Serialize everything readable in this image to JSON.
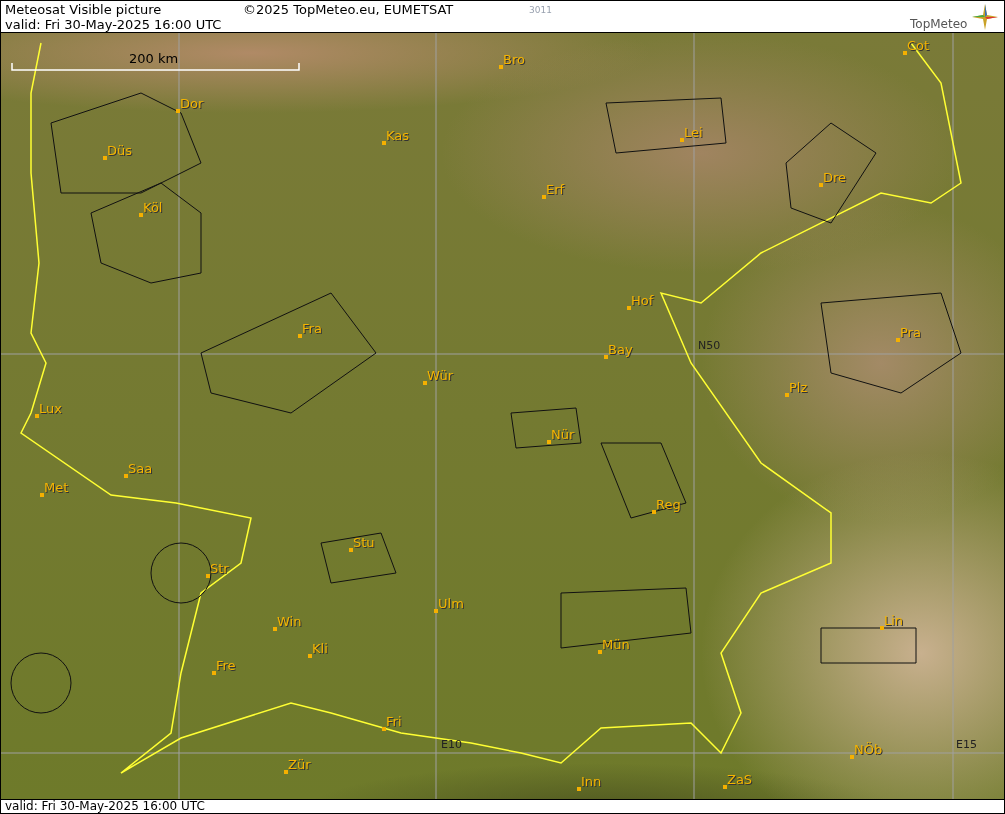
{
  "header": {
    "title": "Meteosat Visible picture",
    "copyright": "©2025 TopMeteo.eu, EUMETSAT",
    "code": "3011",
    "valid": "valid:  Fri  30-May-2025  16:00 UTC",
    "logo": "TopMeteo"
  },
  "map": {
    "scale": "200 km",
    "grid_labels": [
      "N50",
      "E10",
      "E15"
    ],
    "cities": [
      "Bro",
      "Cot",
      "Dor",
      "Kas",
      "Lei",
      "Düs",
      "Dre",
      "Köl",
      "Erf",
      "Fra",
      "Hof",
      "Pra",
      "Bay",
      "Wür",
      "Plz",
      "Lux",
      "Nür",
      "Saa",
      "Met",
      "Reg",
      "Stu",
      "Str",
      "Ulm",
      "Lin",
      "Win",
      "Mün",
      "Kli",
      "Fre",
      "Fri",
      "NÖb",
      "Zür",
      "ZaS",
      "Inn"
    ]
  },
  "footer": {
    "valid": "valid:  Fri  30-May-2025  16:00 UTC"
  }
}
